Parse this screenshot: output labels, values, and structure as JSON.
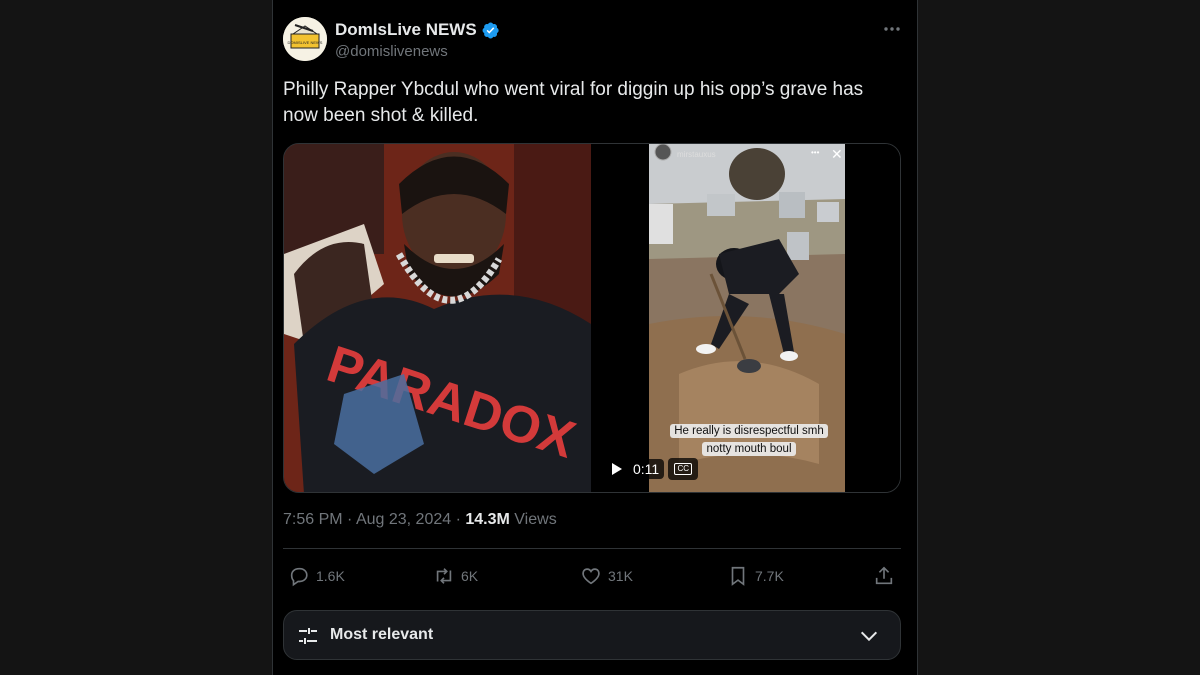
{
  "author": {
    "display_name": "DomIsLive NEWS",
    "handle": "@domislivenews",
    "avatar_text": "DOMISLIVE NEWS",
    "verified": true
  },
  "tweet": {
    "text": "Philly Rapper Ybcdul who went viral for diggin up his opp’s grave has now been shot & killed."
  },
  "media": {
    "left_image": "photo-of-rapper",
    "video": {
      "story_user": "mirstauxus",
      "caption_line1": "He really is disrespectful smh",
      "caption_line2": "notty mouth boul",
      "duration": "0:11",
      "cc_label": "CC"
    }
  },
  "meta": {
    "time": "7:56 PM",
    "separator": "·",
    "date": "Aug 23, 2024",
    "views_count": "14.3M",
    "views_label": "Views"
  },
  "actions": {
    "replies": "1.6K",
    "reposts": "6K",
    "likes": "31K",
    "bookmarks": "7.7K"
  },
  "sort": {
    "label": "Most relevant"
  },
  "colors": {
    "background": "#000000",
    "side_panels": "#141414",
    "text_primary": "#e7e9ea",
    "text_secondary": "#71767b",
    "verified_badge": "#1d9bf0",
    "border": "#2f3336"
  }
}
